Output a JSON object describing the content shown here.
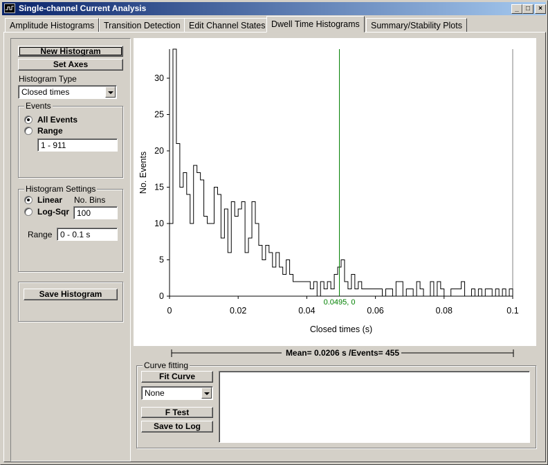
{
  "window": {
    "title": "Single-channel Current Analysis",
    "controls": {
      "minimize": "_",
      "maximize": "□",
      "close": "×"
    }
  },
  "tabs": [
    {
      "label": "Amplitude Histograms",
      "active": false
    },
    {
      "label": "Transition Detection",
      "active": false
    },
    {
      "label": "Edit Channel States",
      "active": false
    },
    {
      "label": "Dwell Time Histograms",
      "active": true
    },
    {
      "label": "Summary/Stability Plots",
      "active": false
    }
  ],
  "sidebar": {
    "new_histogram_label": "New Histogram",
    "set_axes_label": "Set Axes",
    "histogram_type_label": "Histogram Type",
    "histogram_type_value": "Closed times",
    "events": {
      "title": "Events",
      "all_events_label": "All Events",
      "range_label": "Range",
      "range_value": "1 - 911",
      "selected": "all"
    },
    "settings": {
      "title": "Histogram Settings",
      "linear_label": "Linear",
      "logsqr_label": "Log-Sqr",
      "selected": "linear",
      "no_bins_label": "No. Bins",
      "no_bins_value": "100",
      "range_label": "Range",
      "range_value": "0 - 0.1 s"
    },
    "save_histogram_label": "Save Histogram"
  },
  "chart_data": {
    "type": "bar",
    "xlabel": "Closed times (s)",
    "ylabel": "No. Events",
    "xlim": [
      0,
      0.1
    ],
    "ylim": [
      0,
      34
    ],
    "x_ticks": [
      "0",
      "0.02",
      "0.04",
      "0.06",
      "0.08",
      "0.1"
    ],
    "y_ticks": [
      "0",
      "5",
      "10",
      "15",
      "20",
      "25",
      "30"
    ],
    "bin_width": 0.001,
    "values": [
      10,
      34,
      21,
      15,
      17,
      14,
      10,
      18,
      17,
      16,
      11,
      10,
      10,
      15,
      14,
      8,
      12,
      6,
      13,
      11,
      12,
      13,
      6,
      8,
      13,
      10,
      7,
      5,
      7,
      6,
      4,
      6,
      4,
      3,
      5,
      3,
      2,
      2,
      2,
      2,
      2,
      1,
      2,
      0,
      2,
      1,
      2,
      1,
      3,
      4,
      5,
      2,
      1,
      3,
      1,
      2,
      1,
      1,
      1,
      1,
      1,
      1,
      0,
      1,
      1,
      0,
      2,
      2,
      0,
      1,
      1,
      0,
      2,
      1,
      0,
      0,
      2,
      0,
      2,
      1,
      0,
      0,
      1,
      1,
      1,
      2,
      0,
      0,
      1,
      0,
      1,
      0,
      1,
      1,
      0,
      1,
      0,
      1,
      0,
      1
    ],
    "cursor": {
      "x": 0.0495,
      "label": "0.0495, 0",
      "color": "#008000"
    },
    "grid": false
  },
  "stats": {
    "summary": "Mean= 0.0206 s /Events= 455"
  },
  "curve_fitting": {
    "title": "Curve fitting",
    "fit_curve_label": "Fit Curve",
    "equation_value": "None",
    "f_test_label": "F Test",
    "save_to_log_label": "Save to Log",
    "results_text": ""
  }
}
